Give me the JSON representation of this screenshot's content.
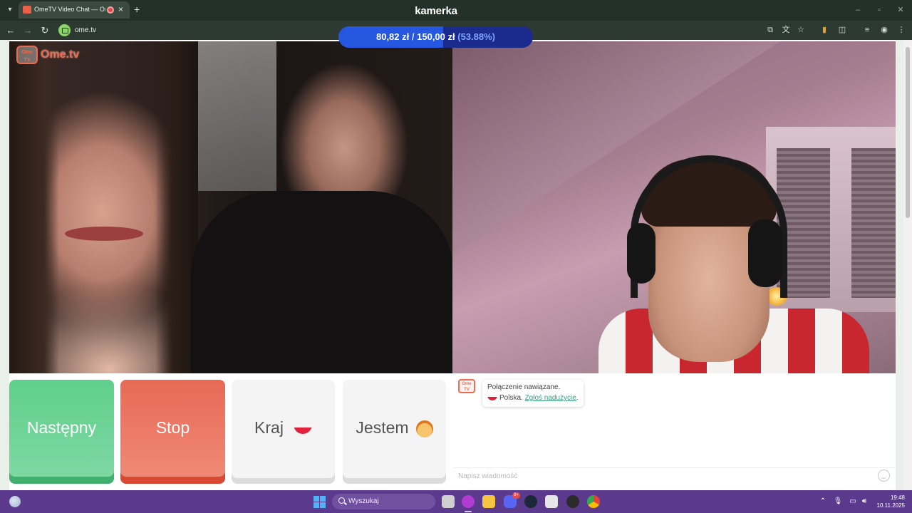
{
  "browser": {
    "tab_title": "OmeTV Video Chat — Ome",
    "url": "ome.tv",
    "overlay_brand": "kamerka"
  },
  "goal": {
    "current": "80,82 zł",
    "separator": "/",
    "target": "150,00 zł",
    "percent_label": "(53.88%)",
    "progress": 0.5388,
    "fill_color": "#2557e0",
    "track_color": "#1b2a8d"
  },
  "site": {
    "logo_word": "Ome.tv",
    "logo_badge": "Ome TV"
  },
  "controls": {
    "next_label": "Następny",
    "stop_label": "Stop",
    "country_label": "Kraj",
    "gender_label": "Jestem",
    "next_color": "#5fcf8c",
    "stop_color": "#e86a55"
  },
  "chat": {
    "avatar_label": "Ome TV",
    "status_line": "Połączenie nawiązane.",
    "country_text": "Polska.",
    "report_link": "Zgłoś nadużycie",
    "report_suffix": ".",
    "input_placeholder": "Napisz wiadomość",
    "link_color": "#3aa07a"
  },
  "taskbar": {
    "search_placeholder": "Wyszukaj",
    "discord_badge": "9+",
    "time": "19:48",
    "date": "10.11.2025",
    "background": "#5b3a8e"
  },
  "icons": {
    "tab_list": "chevron-down-icon",
    "back": "arrow-left-icon",
    "forward": "arrow-right-icon",
    "reload": "reload-icon",
    "minimize": "minimize-icon",
    "maximize": "maximize-icon",
    "close": "close-icon"
  }
}
